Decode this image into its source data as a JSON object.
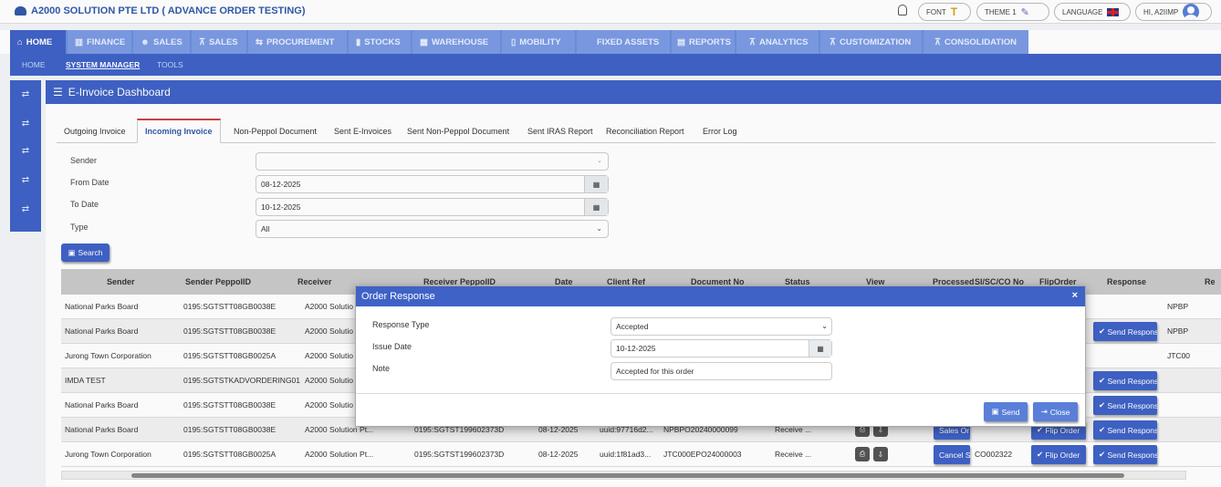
{
  "app": {
    "title": "A2000 SOLUTION PTE LTD ( ADVANCE ORDER TESTING)"
  },
  "topbar": {
    "font_label": "FONT",
    "theme_label": "THEME 1",
    "language_label": "LANGUAGE",
    "user_label": "HI, A2IIMP"
  },
  "mainnav": [
    "HOME",
    "FINANCE",
    "SALES",
    "SALES",
    "PROCUREMENT",
    "STOCKS",
    "WAREHOUSE",
    "MOBILITY",
    "FIXED ASSETS",
    "REPORTS",
    "ANALYTICS",
    "CUSTOMIZATION",
    "CONSOLIDATION"
  ],
  "subnav": [
    "HOME",
    "SYSTEM MANAGER",
    "TOOLS"
  ],
  "panel": {
    "title": "E-Invoice Dashboard"
  },
  "tabs": [
    "Outgoing Invoice",
    "Incoming Invoice",
    "Non-Peppol Document",
    "Sent E-Invoices",
    "Sent Non-Peppol Document",
    "Sent IRAS Report",
    "Reconciliation Report",
    "Error Log"
  ],
  "filters": {
    "sender_label": "Sender",
    "sender_value": "",
    "from_label": "From Date",
    "from_value": "08-12-2025",
    "to_label": "To Date",
    "to_value": "10-12-2025",
    "type_label": "Type",
    "type_value": "All",
    "search_label": "Search"
  },
  "table": {
    "headers": [
      "Sender",
      "Sender PeppolID",
      "Receiver",
      "Receiver PeppolID",
      "Date",
      "Client Ref",
      "Document No",
      "Status",
      "View",
      "Processed",
      "SI/SC/CO No",
      "FlipOrder",
      "Response",
      "Re"
    ],
    "rows": [
      {
        "sender": "National Parks Board",
        "peppol": "0195:SGTSTT08GB0038E",
        "receiver": "A2000 Solutio",
        "rpeppol": "",
        "date": "",
        "ref": "",
        "doc": "",
        "status": "",
        "processed": "",
        "sino": "",
        "flip": "",
        "response": "",
        "re": "NPBP"
      },
      {
        "sender": "National Parks Board",
        "peppol": "0195:SGTSTT08GB0038E",
        "receiver": "A2000 Solutio",
        "rpeppol": "",
        "date": "",
        "ref": "",
        "doc": "",
        "status": "",
        "processed": "",
        "sino": "",
        "flip": "",
        "response": "Send Respons",
        "re": "NPBP"
      },
      {
        "sender": "Jurong Town Corporation",
        "peppol": "0195:SGTSTT08GB0025A",
        "receiver": "A2000 Solutio",
        "rpeppol": "",
        "date": "",
        "ref": "",
        "doc": "",
        "status": "",
        "processed": "",
        "sino": "",
        "flip": "",
        "response": "",
        "re": "JTC00"
      },
      {
        "sender": "IMDA TEST",
        "peppol": "0195:SGTSTKADVORDERING01",
        "receiver": "A2000 Solutio",
        "rpeppol": "",
        "date": "",
        "ref": "",
        "doc": "",
        "status": "",
        "processed": "",
        "sino": "",
        "flip": "",
        "response": "Send Respons",
        "re": ""
      },
      {
        "sender": "National Parks Board",
        "peppol": "0195:SGTSTT08GB0038E",
        "receiver": "A2000 Solutio",
        "rpeppol": "",
        "date": "",
        "ref": "",
        "doc": "",
        "status": "",
        "processed": "",
        "sino": "",
        "flip": "",
        "response": "Send Respons",
        "re": ""
      },
      {
        "sender": "National Parks Board",
        "peppol": "0195:SGTSTT08GB0038E",
        "receiver": "A2000 Solution Pt...",
        "rpeppol": "0195:SGTST199602373D",
        "date": "08-12-2025",
        "ref": "uuid:97716d2...",
        "doc": "NPBPO20240000099",
        "status": "Receive ...",
        "processed": "Sales Or",
        "sino": "",
        "flip": "Flip Order",
        "response": "Send Respons",
        "re": ""
      },
      {
        "sender": "Jurong Town Corporation",
        "peppol": "0195:SGTSTT08GB0025A",
        "receiver": "A2000 Solution Pt...",
        "rpeppol": "0195:SGTST199602373D",
        "date": "08-12-2025",
        "ref": "uuid:1f81ad3...",
        "doc": "JTC000EPO24000003",
        "status": "Receive ...",
        "processed": "Cancel S",
        "sino": "CO002322",
        "flip": "Flip Order",
        "response": "Send Respons",
        "re": ""
      }
    ]
  },
  "modal": {
    "title": "Order Response",
    "close_x": "×",
    "response_type_label": "Response Type",
    "response_type_value": "Accepted",
    "issue_date_label": "Issue Date",
    "issue_date_value": "10-12-2025",
    "note_label": "Note",
    "note_value": "Accepted for this order",
    "send_label": "Send",
    "close_label": "Close"
  },
  "colors": {
    "primary": "#3f62c6",
    "nav": "#6b8fde",
    "header_text": "#2f5aa8"
  }
}
